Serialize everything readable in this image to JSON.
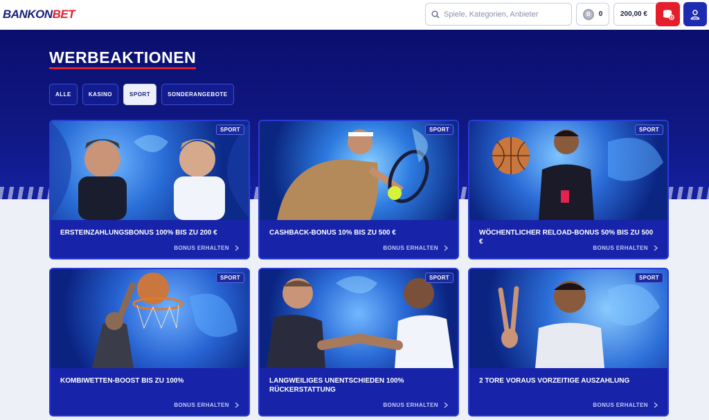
{
  "brand": {
    "part1": "BANKON",
    "part2": "BET"
  },
  "header": {
    "search_placeholder": "Spiele, Kategorien, Anbieter",
    "coin_symbol": "B",
    "coin_count": "0",
    "balance": "200,00 €"
  },
  "page": {
    "title": "WERBEAKTIONEN"
  },
  "tabs": [
    {
      "label": "ALLE",
      "active": false
    },
    {
      "label": "KASINO",
      "active": false
    },
    {
      "label": "SPORT",
      "active": true
    },
    {
      "label": "SONDERANGEBOTE",
      "active": false
    }
  ],
  "promotions": [
    {
      "badge": "SPORT",
      "title": "ERSTEINZAHLUNGSBONUS 100% BIS ZU 200 €",
      "cta": "BONUS ERHALTEN"
    },
    {
      "badge": "SPORT",
      "title": "CASHBACK-BONUS 10% BIS ZU 500 €",
      "cta": "BONUS ERHALTEN"
    },
    {
      "badge": "SPORT",
      "title": "WÖCHENTLICHER RELOAD-BONUS 50% BIS ZU 500 €",
      "cta": "BONUS ERHALTEN"
    },
    {
      "badge": "SPORT",
      "title": "KOMBIWETTEN-BOOST BIS ZU 100%",
      "cta": "BONUS ERHALTEN"
    },
    {
      "badge": "SPORT",
      "title": "LANGWEILIGES UNENTSCHIEDEN 100% RÜCKERSTATTUNG",
      "cta": "BONUS ERHALTEN"
    },
    {
      "badge": "SPORT",
      "title": "2 TORE VORAUS VORZEITIGE AUSZAHLUNG",
      "cta": "BONUS ERHALTEN"
    }
  ],
  "colors": {
    "brand_navy": "#16217a",
    "brand_red": "#e41e2b",
    "hero_blue": "#0a0f6e",
    "card_blue": "#1723a8"
  }
}
